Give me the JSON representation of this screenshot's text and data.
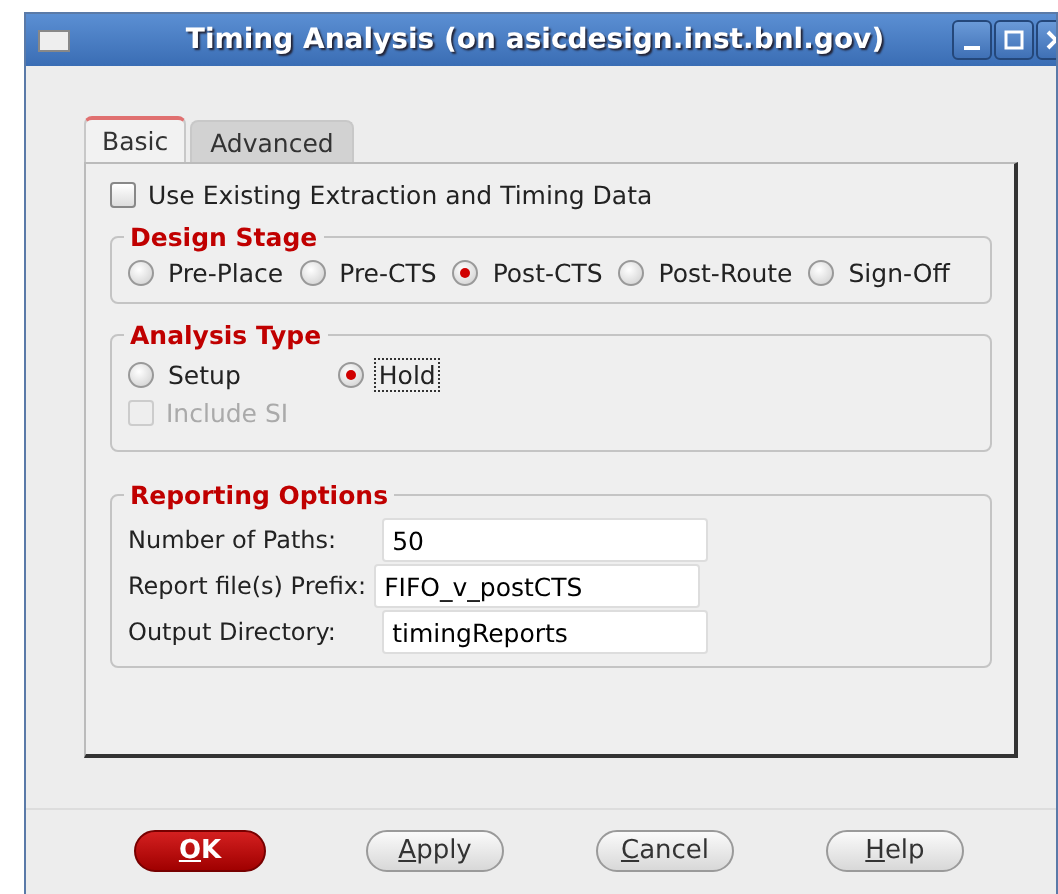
{
  "window": {
    "title": "Timing Analysis (on asicdesign.inst.bnl.gov)"
  },
  "tabs": [
    {
      "label": "Basic",
      "selected": true
    },
    {
      "label": "Advanced",
      "selected": false
    }
  ],
  "use_existing": {
    "label": "Use Existing Extraction and Timing Data",
    "checked": false,
    "disabled": false
  },
  "design_stage": {
    "title": "Design Stage",
    "options": [
      {
        "label": "Pre-Place",
        "selected": false,
        "focused": false
      },
      {
        "label": "Pre-CTS",
        "selected": false,
        "focused": false
      },
      {
        "label": "Post-CTS",
        "selected": true,
        "focused": false
      },
      {
        "label": "Post-Route",
        "selected": false,
        "focused": false
      },
      {
        "label": "Sign-Off",
        "selected": false,
        "focused": false
      }
    ]
  },
  "analysis_type": {
    "title": "Analysis Type",
    "options": [
      {
        "label": "Setup",
        "selected": false,
        "focused": false
      },
      {
        "label": "Hold",
        "selected": true,
        "focused": true
      }
    ],
    "include_si": {
      "label": "Include SI",
      "checked": false,
      "disabled": true
    }
  },
  "reporting_options": {
    "title": "Reporting Options",
    "fields": [
      {
        "label": "Number of Paths:",
        "value": "50"
      },
      {
        "label": "Report file(s) Prefix:",
        "value": "FIFO_v_postCTS"
      },
      {
        "label": "Output Directory:",
        "value": "timingReports"
      }
    ]
  },
  "buttons": [
    {
      "label": "OK",
      "kind": "default"
    },
    {
      "label": "Apply",
      "kind": "normal"
    },
    {
      "label": "Cancel",
      "kind": "normal"
    },
    {
      "label": "Help",
      "kind": "normal"
    }
  ]
}
